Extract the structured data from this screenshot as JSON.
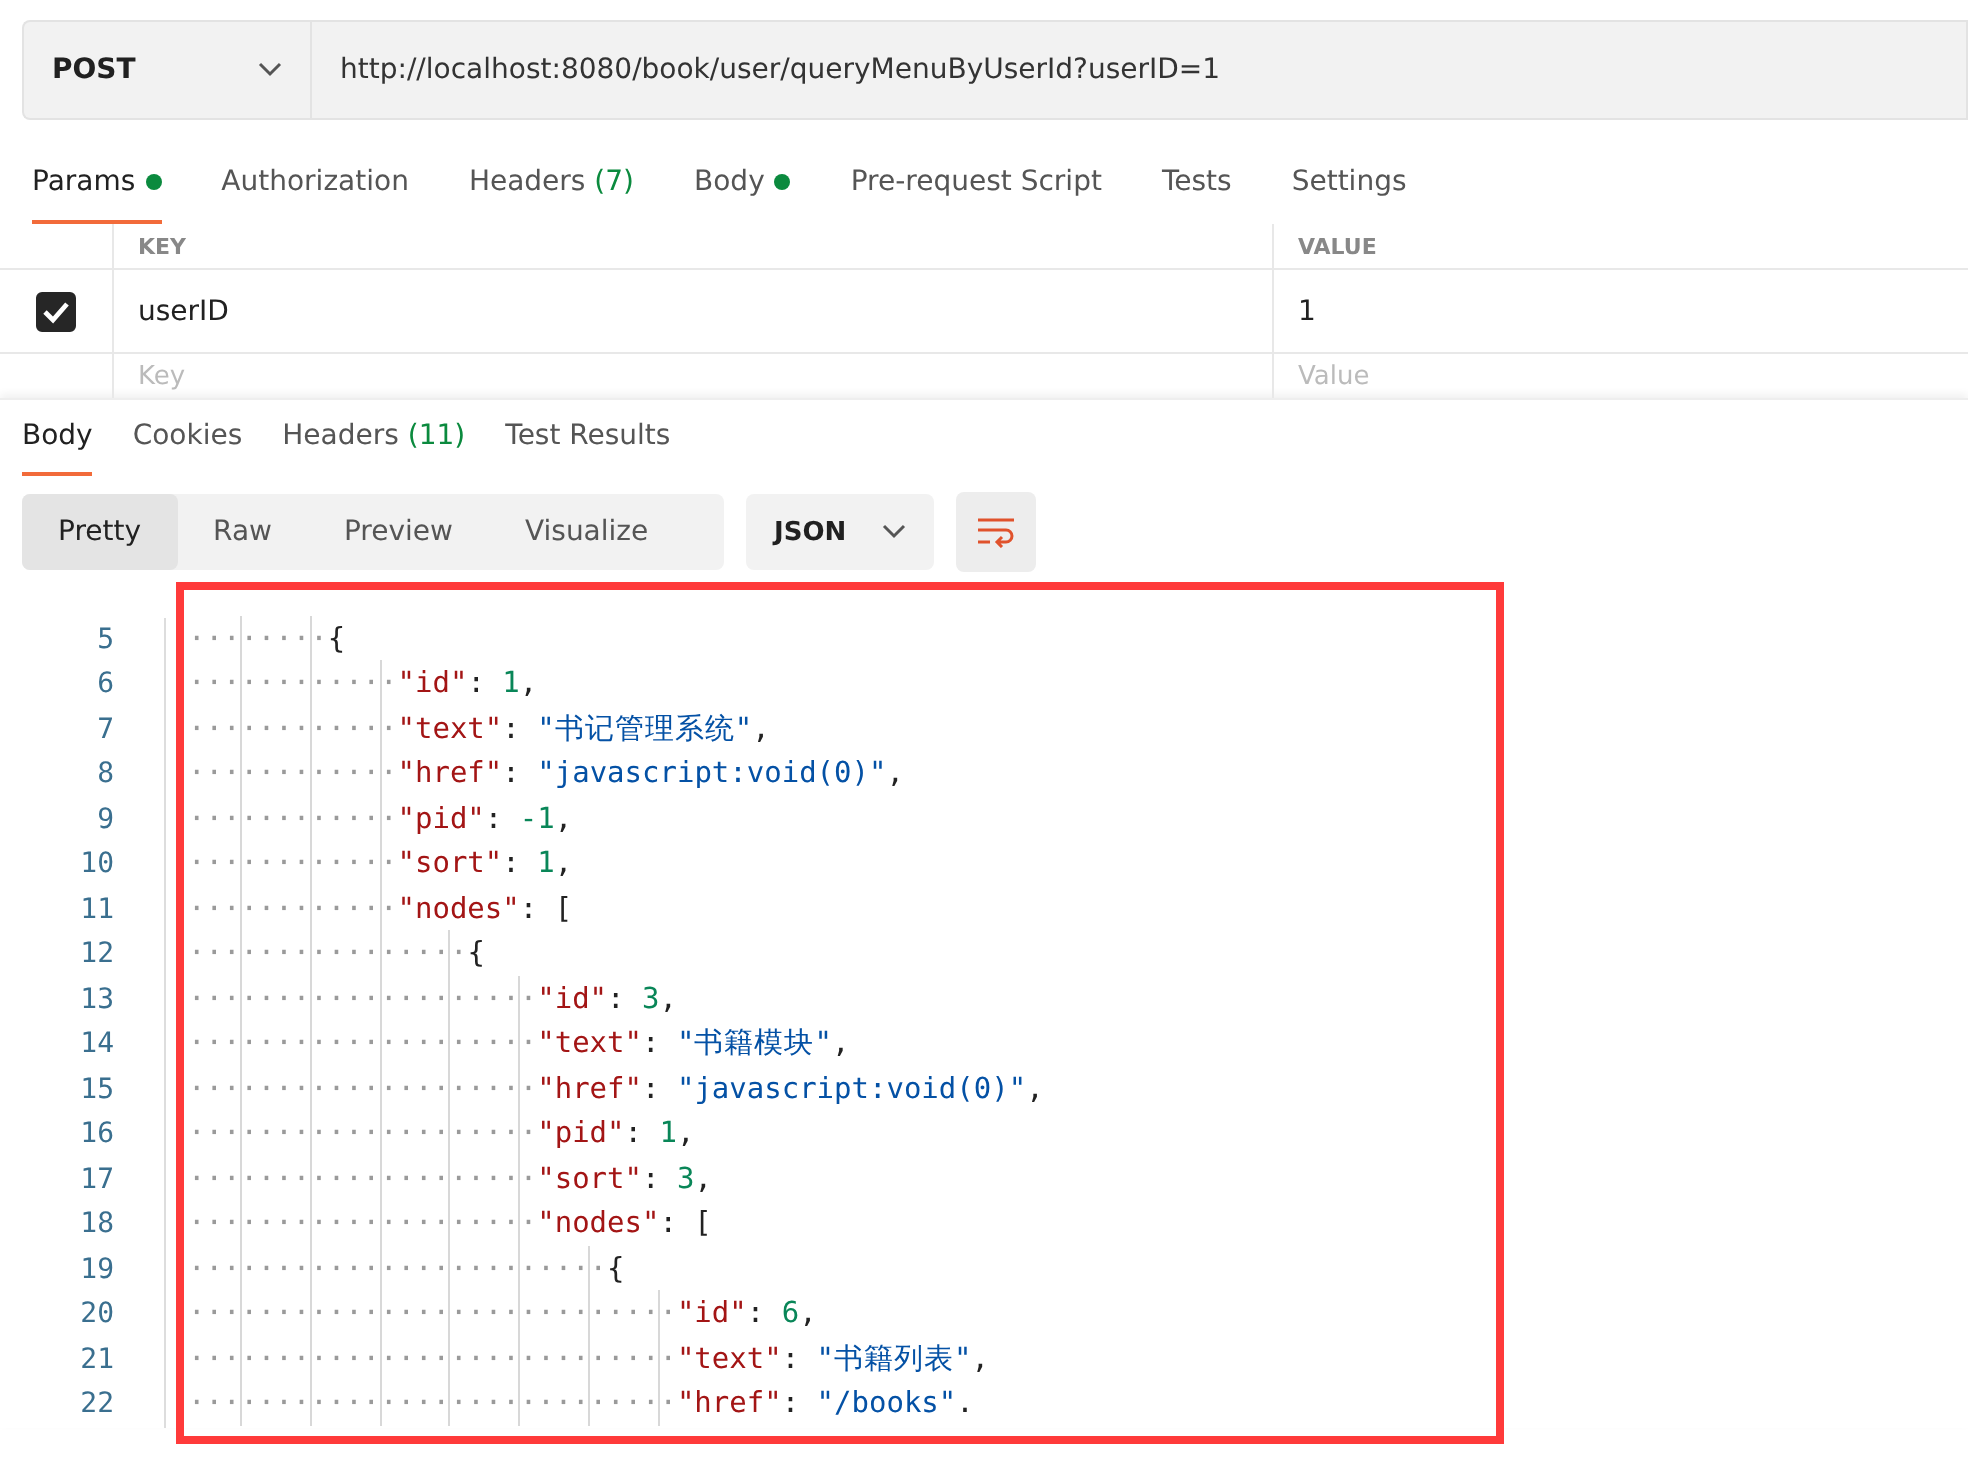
{
  "request": {
    "method": "POST",
    "url": "http://localhost:8080/book/user/queryMenuByUserId?userID=1"
  },
  "request_tabs": [
    {
      "label": "Params",
      "selected": true,
      "dot": true
    },
    {
      "label": "Authorization",
      "selected": false,
      "dot": false
    },
    {
      "label": "Headers",
      "count": "(7)",
      "selected": false,
      "dot": false
    },
    {
      "label": "Body",
      "selected": false,
      "dot": true
    },
    {
      "label": "Pre-request Script",
      "selected": false,
      "dot": false
    },
    {
      "label": "Tests",
      "selected": false,
      "dot": false
    },
    {
      "label": "Settings",
      "selected": false,
      "dot": false
    }
  ],
  "params": {
    "columns": [
      "KEY",
      "VALUE"
    ],
    "rows": [
      {
        "checked": true,
        "key": "userID",
        "value": "1"
      }
    ],
    "new_row": {
      "key_placeholder": "Key",
      "value_placeholder": "Value"
    }
  },
  "response_tabs": [
    {
      "label": "Body",
      "selected": true
    },
    {
      "label": "Cookies",
      "selected": false
    },
    {
      "label": "Headers",
      "count": "(11)",
      "selected": false
    },
    {
      "label": "Test Results",
      "selected": false
    }
  ],
  "view_modes": [
    {
      "label": "Pretty",
      "selected": true
    },
    {
      "label": "Raw",
      "selected": false
    },
    {
      "label": "Preview",
      "selected": false
    },
    {
      "label": "Visualize",
      "selected": false
    }
  ],
  "format": "JSON",
  "code_lines": [
    {
      "number": "5",
      "indent": "········",
      "tokens": [
        {
          "kind": "punct",
          "text": "{"
        }
      ]
    },
    {
      "number": "6",
      "indent": "············",
      "tokens": [
        {
          "kind": "key",
          "text": "\"id\""
        },
        {
          "kind": "punct",
          "text": ": "
        },
        {
          "kind": "num",
          "text": "1"
        },
        {
          "kind": "punct",
          "text": ","
        }
      ]
    },
    {
      "number": "7",
      "indent": "············",
      "tokens": [
        {
          "kind": "key",
          "text": "\"text\""
        },
        {
          "kind": "punct",
          "text": ": "
        },
        {
          "kind": "str",
          "text": "\"书记管理系统\""
        },
        {
          "kind": "punct",
          "text": ","
        }
      ]
    },
    {
      "number": "8",
      "indent": "············",
      "tokens": [
        {
          "kind": "key",
          "text": "\"href\""
        },
        {
          "kind": "punct",
          "text": ": "
        },
        {
          "kind": "str",
          "text": "\"javascript:void(0)\""
        },
        {
          "kind": "punct",
          "text": ","
        }
      ]
    },
    {
      "number": "9",
      "indent": "············",
      "tokens": [
        {
          "kind": "key",
          "text": "\"pid\""
        },
        {
          "kind": "punct",
          "text": ": "
        },
        {
          "kind": "num",
          "text": "-1"
        },
        {
          "kind": "punct",
          "text": ","
        }
      ]
    },
    {
      "number": "10",
      "indent": "············",
      "tokens": [
        {
          "kind": "key",
          "text": "\"sort\""
        },
        {
          "kind": "punct",
          "text": ": "
        },
        {
          "kind": "num",
          "text": "1"
        },
        {
          "kind": "punct",
          "text": ","
        }
      ]
    },
    {
      "number": "11",
      "indent": "············",
      "tokens": [
        {
          "kind": "key",
          "text": "\"nodes\""
        },
        {
          "kind": "punct",
          "text": ": ["
        }
      ]
    },
    {
      "number": "12",
      "indent": "················",
      "tokens": [
        {
          "kind": "punct",
          "text": "{"
        }
      ]
    },
    {
      "number": "13",
      "indent": "····················",
      "tokens": [
        {
          "kind": "key",
          "text": "\"id\""
        },
        {
          "kind": "punct",
          "text": ": "
        },
        {
          "kind": "num",
          "text": "3"
        },
        {
          "kind": "punct",
          "text": ","
        }
      ]
    },
    {
      "number": "14",
      "indent": "····················",
      "tokens": [
        {
          "kind": "key",
          "text": "\"text\""
        },
        {
          "kind": "punct",
          "text": ": "
        },
        {
          "kind": "str",
          "text": "\"书籍模块\""
        },
        {
          "kind": "punct",
          "text": ","
        }
      ]
    },
    {
      "number": "15",
      "indent": "····················",
      "tokens": [
        {
          "kind": "key",
          "text": "\"href\""
        },
        {
          "kind": "punct",
          "text": ": "
        },
        {
          "kind": "str",
          "text": "\"javascript:void(0)\""
        },
        {
          "kind": "punct",
          "text": ","
        }
      ]
    },
    {
      "number": "16",
      "indent": "····················",
      "tokens": [
        {
          "kind": "key",
          "text": "\"pid\""
        },
        {
          "kind": "punct",
          "text": ": "
        },
        {
          "kind": "num",
          "text": "1"
        },
        {
          "kind": "punct",
          "text": ","
        }
      ]
    },
    {
      "number": "17",
      "indent": "····················",
      "tokens": [
        {
          "kind": "key",
          "text": "\"sort\""
        },
        {
          "kind": "punct",
          "text": ": "
        },
        {
          "kind": "num",
          "text": "3"
        },
        {
          "kind": "punct",
          "text": ","
        }
      ]
    },
    {
      "number": "18",
      "indent": "····················",
      "tokens": [
        {
          "kind": "key",
          "text": "\"nodes\""
        },
        {
          "kind": "punct",
          "text": ": ["
        }
      ]
    },
    {
      "number": "19",
      "indent": "························",
      "tokens": [
        {
          "kind": "punct",
          "text": "{"
        }
      ]
    },
    {
      "number": "20",
      "indent": "····························",
      "tokens": [
        {
          "kind": "key",
          "text": "\"id\""
        },
        {
          "kind": "punct",
          "text": ": "
        },
        {
          "kind": "num",
          "text": "6"
        },
        {
          "kind": "punct",
          "text": ","
        }
      ]
    },
    {
      "number": "21",
      "indent": "····························",
      "tokens": [
        {
          "kind": "key",
          "text": "\"text\""
        },
        {
          "kind": "punct",
          "text": ": "
        },
        {
          "kind": "str",
          "text": "\"书籍列表\""
        },
        {
          "kind": "punct",
          "text": ","
        }
      ]
    },
    {
      "number": "22",
      "indent": "····························",
      "tokens": [
        {
          "kind": "key",
          "text": "\"href\""
        },
        {
          "kind": "punct",
          "text": ": "
        },
        {
          "kind": "str",
          "text": "\"/books\""
        },
        {
          "kind": "punct",
          "text": "."
        }
      ]
    }
  ]
}
